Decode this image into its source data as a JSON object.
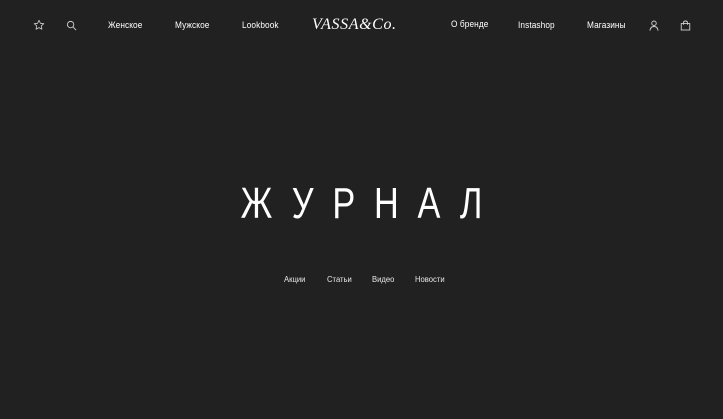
{
  "brand": {
    "logo": "VASSA&Co."
  },
  "header": {
    "icons": {
      "favorites": "star-icon",
      "search": "search-icon",
      "account": "user-icon",
      "cart": "bag-icon"
    },
    "nav_left": [
      {
        "label": "Женское"
      },
      {
        "label": "Мужское"
      },
      {
        "label": "Lookbook"
      }
    ],
    "nav_right": [
      {
        "label": "О бренде"
      },
      {
        "label": "Instashop"
      },
      {
        "label": "Магазины"
      }
    ]
  },
  "main": {
    "title": "ЖУРНАЛ",
    "categories": [
      {
        "label": "Акции"
      },
      {
        "label": "Статьи"
      },
      {
        "label": "Видео"
      },
      {
        "label": "Новости"
      }
    ]
  },
  "colors": {
    "background": "#212121",
    "text": "#ffffff"
  }
}
